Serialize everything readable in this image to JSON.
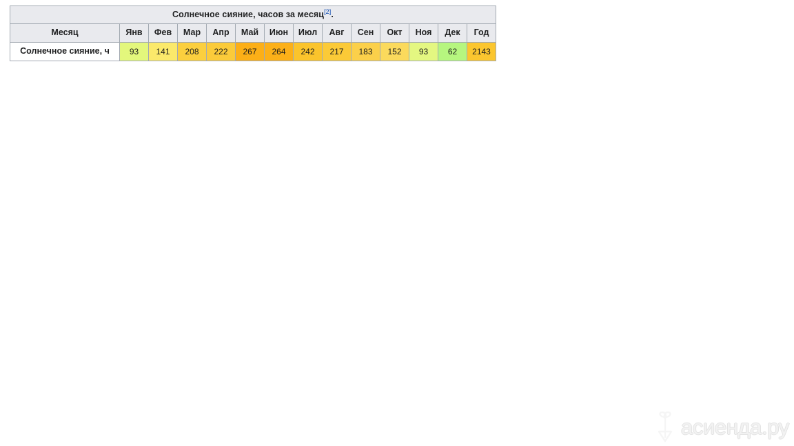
{
  "table": {
    "title_text": "Солнечное сияние, часов за месяц",
    "title_ref": "[2]",
    "title_suffix": ".",
    "header": {
      "corner_label": "Месяц",
      "columns": [
        "Янв",
        "Фев",
        "Мар",
        "Апр",
        "Май",
        "Июн",
        "Июл",
        "Авг",
        "Сен",
        "Окт",
        "Ноя",
        "Дек",
        "Год"
      ]
    },
    "row": {
      "label": "Солнечное сияние, ч",
      "values": [
        "93",
        "141",
        "208",
        "222",
        "267",
        "264",
        "242",
        "217",
        "183",
        "152",
        "93",
        "62",
        "2143"
      ],
      "cell_colors": [
        "#e3f77c",
        "#fbe96b",
        "#fbcf3e",
        "#fbcb3a",
        "#fcaf17",
        "#fcb018",
        "#fbc42c",
        "#fbca37",
        "#fbd04a",
        "#fbda5c",
        "#e4f781",
        "#b6f67f",
        "#fbc62f"
      ]
    },
    "colors": {
      "border": "#a2a9b1",
      "header_background": "#e9eaee",
      "text": "#202122",
      "link": "#0645ad",
      "page_background": "#ffffff"
    }
  },
  "watermark": {
    "text": "асиенда.ру",
    "logo_name": "sprout-logo",
    "color": "#f2f2f2"
  },
  "chart_data": {
    "type": "table",
    "title": "Солнечное сияние, часов за месяц",
    "categories": [
      "Янв",
      "Фев",
      "Мар",
      "Апр",
      "Май",
      "Июн",
      "Июл",
      "Авг",
      "Сен",
      "Окт",
      "Ноя",
      "Дек",
      "Год"
    ],
    "series": [
      {
        "name": "Солнечное сияние, ч",
        "values": [
          93,
          141,
          208,
          222,
          267,
          264,
          242,
          217,
          183,
          152,
          93,
          62,
          2143
        ]
      }
    ],
    "xlabel": "Месяц",
    "ylabel": "часов за месяц",
    "grid": true,
    "legend": "none"
  }
}
